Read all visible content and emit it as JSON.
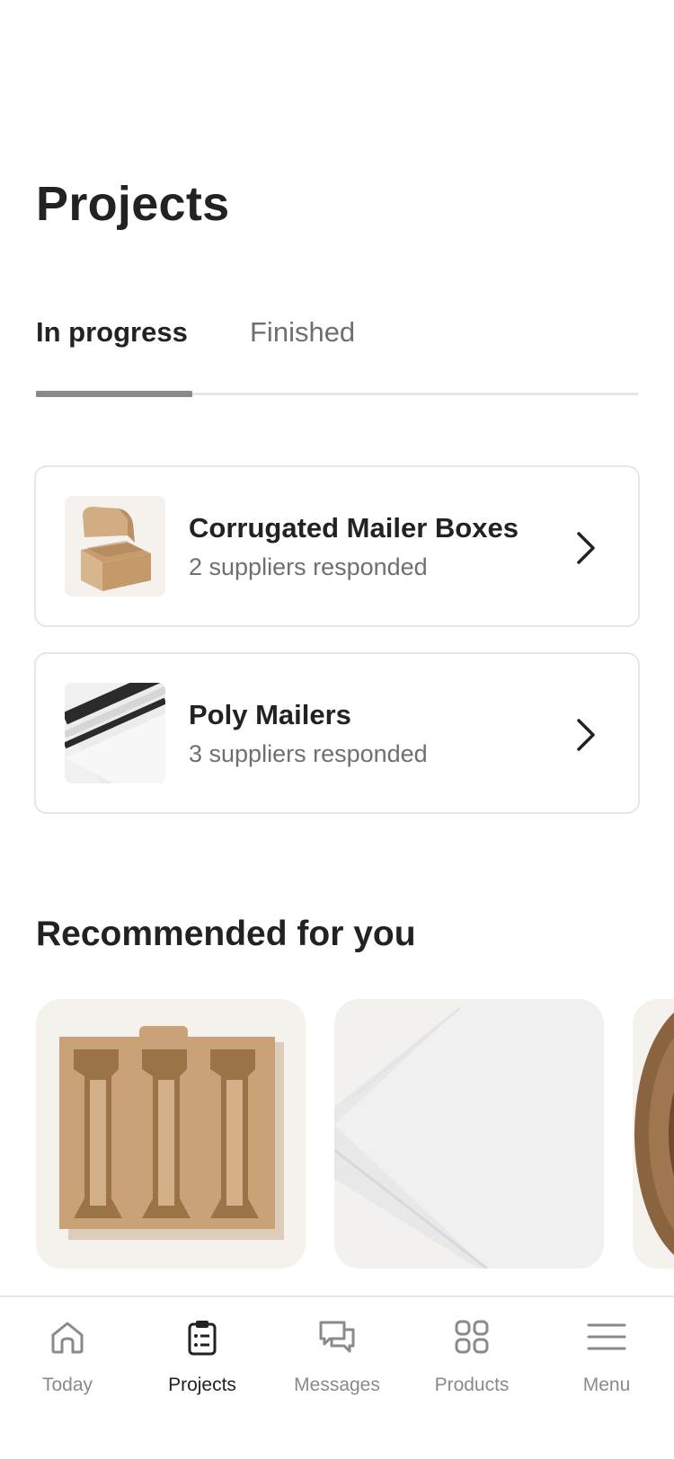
{
  "header": {
    "title": "Projects"
  },
  "tabs": [
    {
      "label": "In progress",
      "active": true
    },
    {
      "label": "Finished",
      "active": false
    }
  ],
  "projects": [
    {
      "title": "Corrugated Mailer Boxes",
      "subtitle": "2 suppliers responded",
      "thumbnail": "mailer-box-image"
    },
    {
      "title": "Poly Mailers",
      "subtitle": "3 suppliers responded",
      "thumbnail": "poly-mailer-image"
    }
  ],
  "recommended": {
    "title": "Recommended for you",
    "items": [
      {
        "image": "bottle-insert-image"
      },
      {
        "image": "white-mailer-image"
      },
      {
        "image": "kraft-tape-image"
      }
    ]
  },
  "nav": [
    {
      "label": "Today",
      "icon": "home-icon",
      "active": false
    },
    {
      "label": "Projects",
      "icon": "clipboard-icon",
      "active": true
    },
    {
      "label": "Messages",
      "icon": "chat-icon",
      "active": false
    },
    {
      "label": "Products",
      "icon": "grid-icon",
      "active": false
    },
    {
      "label": "Menu",
      "icon": "menu-icon",
      "active": false
    }
  ],
  "colors": {
    "text": "#222222",
    "muted": "#6f6f6f",
    "border": "#e6e6e6",
    "cardBg": "#f5f2ed",
    "kraft": "#c9a277"
  }
}
